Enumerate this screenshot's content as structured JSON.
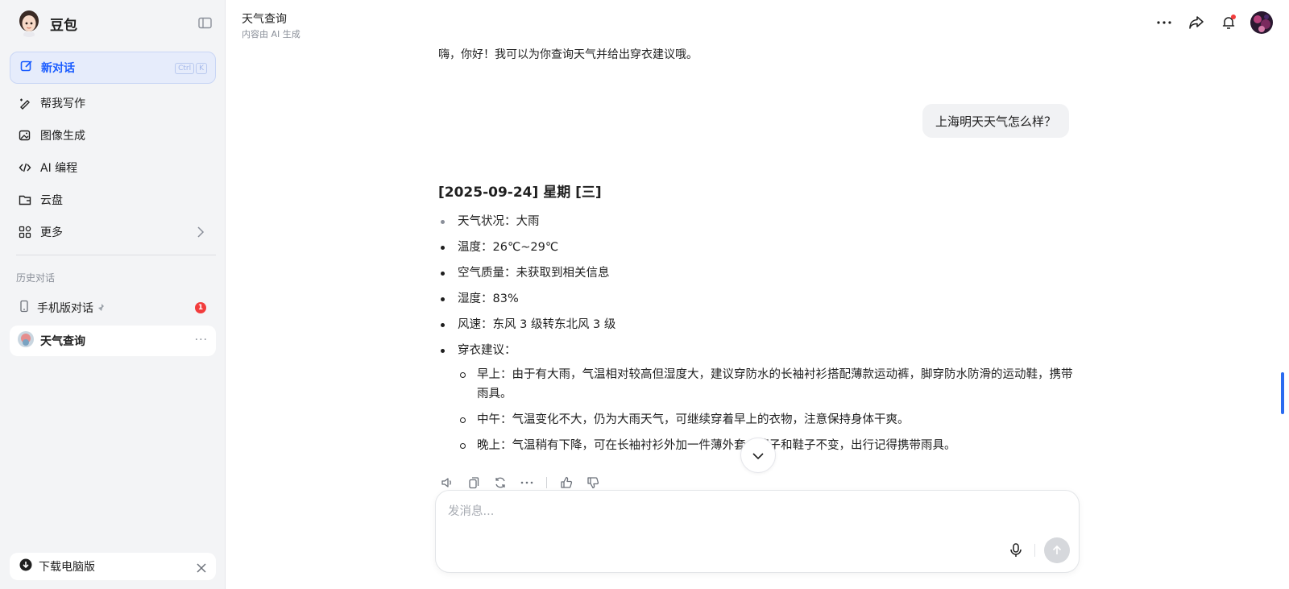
{
  "sidebar": {
    "brand_name": "豆包",
    "new_chat": {
      "label": "新对话",
      "kbd_ctrl": "Ctrl",
      "kbd_key": "K"
    },
    "nav": [
      {
        "label": "帮我写作",
        "icon": "pen-icon"
      },
      {
        "label": "图像生成",
        "icon": "image-icon"
      },
      {
        "label": "AI 编程",
        "icon": "code-icon"
      },
      {
        "label": "云盘",
        "icon": "folder-icon"
      },
      {
        "label": "更多",
        "icon": "apps-icon"
      }
    ],
    "history_title": "历史对话",
    "history": [
      {
        "label": "手机版对话",
        "badge": "1"
      },
      {
        "label": "天气查询",
        "more": "···"
      }
    ],
    "download_label": "下载电脑版"
  },
  "header": {
    "title": "天气查询",
    "subtitle": "内容由 AI 生成"
  },
  "chat": {
    "greeting": "嗨，你好！我可以为你查询天气并给出穿衣建议哦。",
    "user_message": "上海明天天气怎么样？",
    "answer": {
      "heading": "[2025-09-24] 星期 [三]",
      "bullets": [
        "天气状况：大雨",
        "温度：26℃~29℃",
        "空气质量：未获取到相关信息",
        "湿度：83%",
        "风速：东风 3 级转东北风 3 级",
        "穿衣建议："
      ],
      "advice": [
        "早上：由于有大雨，气温相对较高但湿度大，建议穿防水的长袖衬衫搭配薄款运动裤，脚穿防水防滑的运动鞋，携带雨具。",
        "中午：气温变化不大，仍为大雨天气，可继续穿着早上的衣物，注意保持身体干爽。",
        "晚上：气温稍有下降，可在长袖衬衫外加一件薄外套，裤子和鞋子不变，出行记得携带雨具。"
      ]
    }
  },
  "composer": {
    "placeholder": "发消息..."
  },
  "colors": {
    "accent": "#1a5cff",
    "badge": "#f23c3c",
    "sidebar_bg": "#f3f4f6",
    "scrollbar": "#2b6bf0"
  }
}
